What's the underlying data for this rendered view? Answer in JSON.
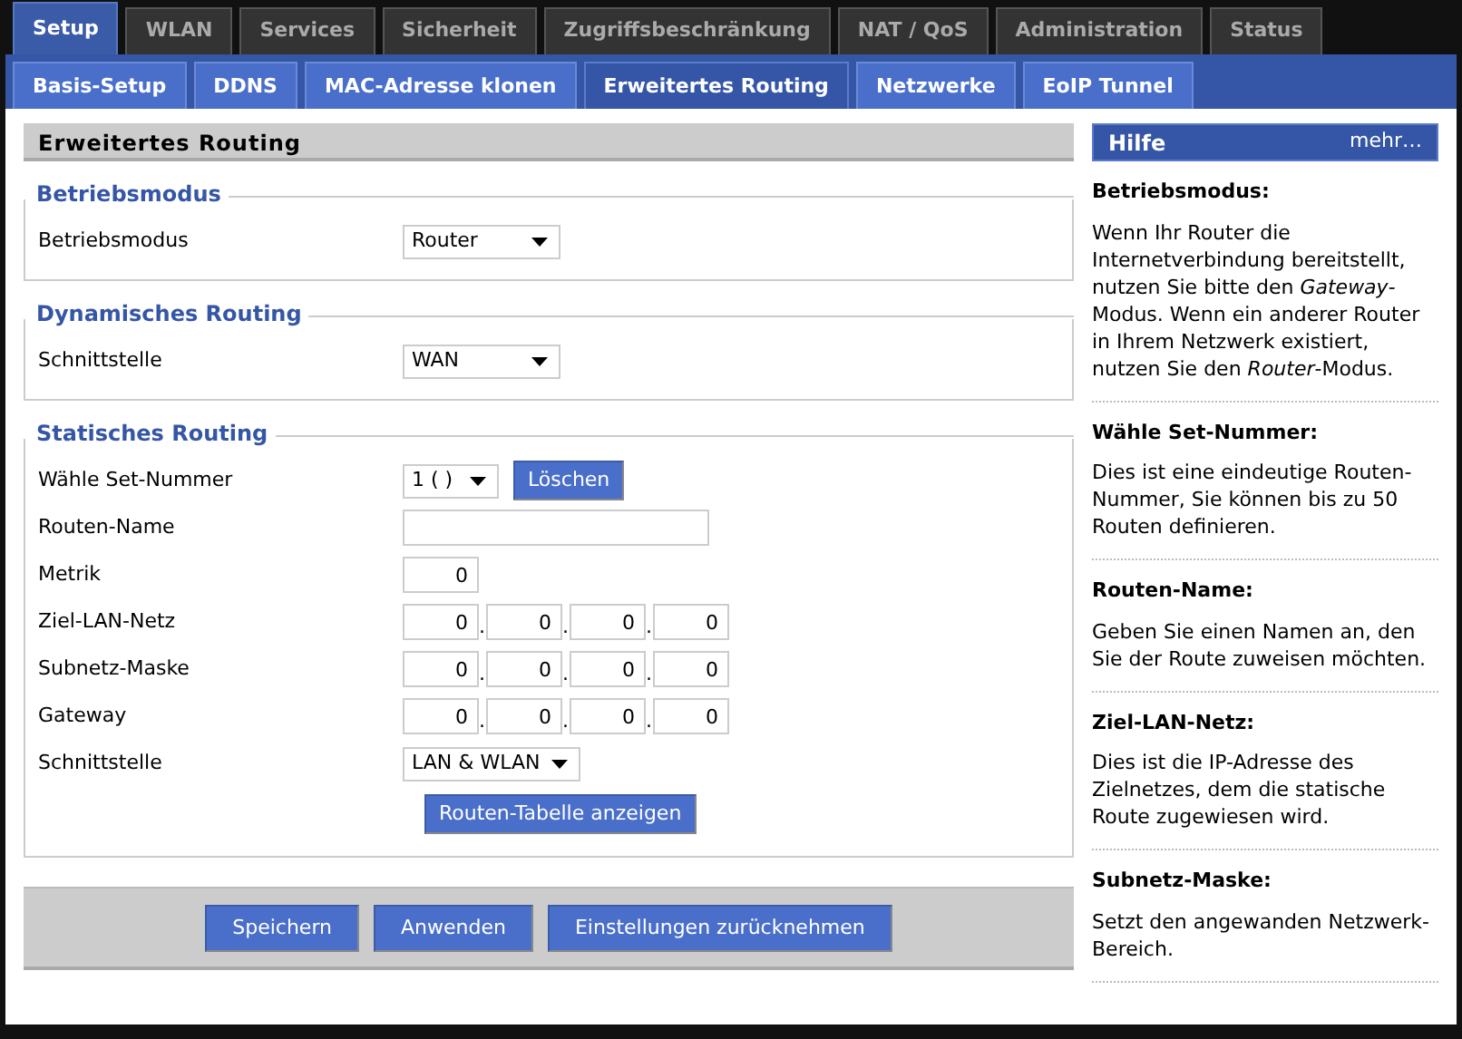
{
  "tabs": [
    {
      "label": "Setup",
      "selected": true
    },
    {
      "label": "WLAN",
      "selected": false
    },
    {
      "label": "Services",
      "selected": false
    },
    {
      "label": "Sicherheit",
      "selected": false
    },
    {
      "label": "Zugriffsbeschränkung",
      "selected": false
    },
    {
      "label": "NAT / QoS",
      "selected": false
    },
    {
      "label": "Administration",
      "selected": false
    },
    {
      "label": "Status",
      "selected": false
    }
  ],
  "subtabs": [
    {
      "label": "Basis-Setup",
      "selected": false
    },
    {
      "label": "DDNS",
      "selected": false
    },
    {
      "label": "MAC-Adresse klonen",
      "selected": false
    },
    {
      "label": "Erweitertes Routing",
      "selected": true
    },
    {
      "label": "Netzwerke",
      "selected": false
    },
    {
      "label": "EoIP Tunnel",
      "selected": false
    }
  ],
  "panel_title": "Erweitertes Routing",
  "sections": [
    {
      "legend": "Betriebsmodus",
      "rows": [
        {
          "kind": "select",
          "label": "Betriebsmodus",
          "value": "Router"
        }
      ]
    },
    {
      "legend": "Dynamisches Routing",
      "rows": [
        {
          "kind": "select",
          "label": "Schnittstelle",
          "value": "WAN"
        }
      ]
    },
    {
      "legend": "Statisches Routing",
      "rows": [
        {
          "kind": "select_button",
          "label": "Wähle Set-Nummer",
          "value": "1 ( )",
          "button": "Löschen"
        },
        {
          "kind": "text",
          "label": "Routen-Name"
        },
        {
          "kind": "number",
          "label": "Metrik",
          "value": "0"
        },
        {
          "kind": "ip",
          "label": "Ziel-LAN-Netz",
          "octets": [
            "0",
            "0",
            "0",
            "0"
          ],
          "separator": "."
        },
        {
          "kind": "ip",
          "label": "Subnetz-Maske",
          "octets": [
            "0",
            "0",
            "0",
            "0"
          ],
          "separator": "."
        },
        {
          "kind": "ip",
          "label": "Gateway",
          "octets": [
            "0",
            "0",
            "0",
            "0"
          ],
          "separator": "."
        },
        {
          "kind": "select",
          "label": "Schnittstelle",
          "value": "LAN & WLAN"
        },
        {
          "kind": "button",
          "button": "Routen-Tabelle anzeigen"
        }
      ]
    }
  ],
  "footer_buttons": [
    "Speichern",
    "Anwenden",
    "Einstellungen zurücknehmen"
  ],
  "help": {
    "title": "Hilfe",
    "more": "mehr…",
    "items": [
      {
        "heading": "Betriebsmodus:",
        "text": "Wenn Ihr Router die Internetverbindung bereitstellt, nutzen Sie bitte den *Gateway*-Modus. Wenn ein anderer Router in Ihrem Netzwerk existiert, nutzen Sie den *Router*-Modus."
      },
      {
        "heading": "Wähle Set-Nummer:",
        "text": "Dies ist eine eindeutige Routen-Nummer, Sie können bis zu 50 Routen definieren."
      },
      {
        "heading": "Routen-Name:",
        "text": "Geben Sie einen Namen an, den Sie der Route zuweisen möchten."
      },
      {
        "heading": "Ziel-LAN-Netz:",
        "text": "Dies ist die IP-Adresse des Zielnetzes, dem die statische Route zugewiesen wird."
      },
      {
        "heading": "Subnetz-Maske:",
        "text": "Setzt den angewanden Netzwerk-Bereich."
      }
    ]
  }
}
